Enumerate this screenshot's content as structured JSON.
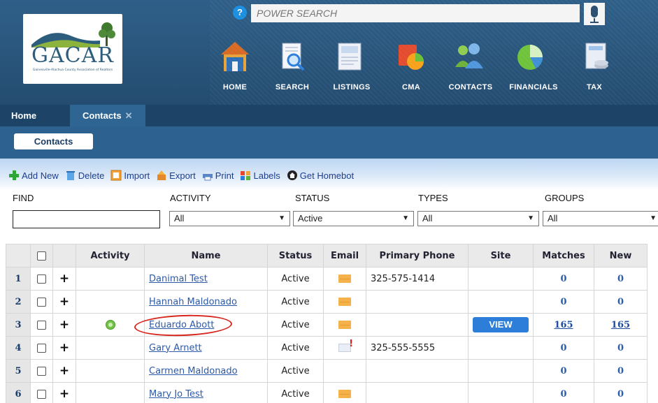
{
  "header": {
    "logo_text": "GACAR",
    "logo_subtitle": "Gainesville-Alachua County Association of Realtors",
    "search_placeholder": "POWER SEARCH",
    "nav": [
      {
        "label": "HOME",
        "icon": "home-icon"
      },
      {
        "label": "SEARCH",
        "icon": "search-icon"
      },
      {
        "label": "LISTINGS",
        "icon": "listings-icon"
      },
      {
        "label": "CMA",
        "icon": "cma-icon"
      },
      {
        "label": "CONTACTS",
        "icon": "contacts-icon"
      },
      {
        "label": "FINANCIALS",
        "icon": "financials-icon"
      },
      {
        "label": "TAX",
        "icon": "tax-icon"
      }
    ]
  },
  "tabs": {
    "home": "Home",
    "contacts": "Contacts",
    "close_glyph": "✕"
  },
  "subnav": {
    "contacts_button": "Contacts"
  },
  "toolbar": {
    "add_new": "Add New",
    "delete": "Delete",
    "import": "Import",
    "export": "Export",
    "print": "Print",
    "labels": "Labels",
    "get_homebot": "Get Homebot"
  },
  "filters": {
    "find_label": "FIND",
    "activity_label": "ACTIVITY",
    "status_label": "STATUS",
    "types_label": "TYPES",
    "groups_label": "GROUPS",
    "activity_value": "All",
    "status_value": "Active",
    "types_value": "All",
    "groups_value": "All",
    "find_value": ""
  },
  "table": {
    "headers": {
      "activity": "Activity",
      "name": "Name",
      "status": "Status",
      "email": "Email",
      "phone": "Primary Phone",
      "site": "Site",
      "matches": "Matches",
      "new": "New"
    },
    "rows": [
      {
        "num": "1",
        "name": "Danimal Test",
        "status": "Active",
        "email": "envelope",
        "phone": "325-575-1414",
        "site": "",
        "matches": "0",
        "new": "0",
        "activity": ""
      },
      {
        "num": "2",
        "name": "Hannah Maldonado",
        "status": "Active",
        "email": "envelope",
        "phone": "",
        "site": "",
        "matches": "0",
        "new": "0",
        "activity": ""
      },
      {
        "num": "3",
        "name": "Eduardo Abott",
        "status": "Active",
        "email": "envelope",
        "phone": "",
        "site": "VIEW",
        "matches": "165",
        "new": "165",
        "activity": "dot"
      },
      {
        "num": "4",
        "name": "Gary Arnett",
        "status": "Active",
        "email": "alert",
        "phone": "325-555-5555",
        "site": "",
        "matches": "0",
        "new": "0",
        "activity": ""
      },
      {
        "num": "5",
        "name": "Carmen Maldonado",
        "status": "Active",
        "email": "",
        "phone": "",
        "site": "",
        "matches": "0",
        "new": "0",
        "activity": ""
      },
      {
        "num": "6",
        "name": "Mary Jo Test",
        "status": "Active",
        "email": "envelope",
        "phone": "",
        "site": "",
        "matches": "0",
        "new": "0",
        "activity": ""
      }
    ]
  }
}
